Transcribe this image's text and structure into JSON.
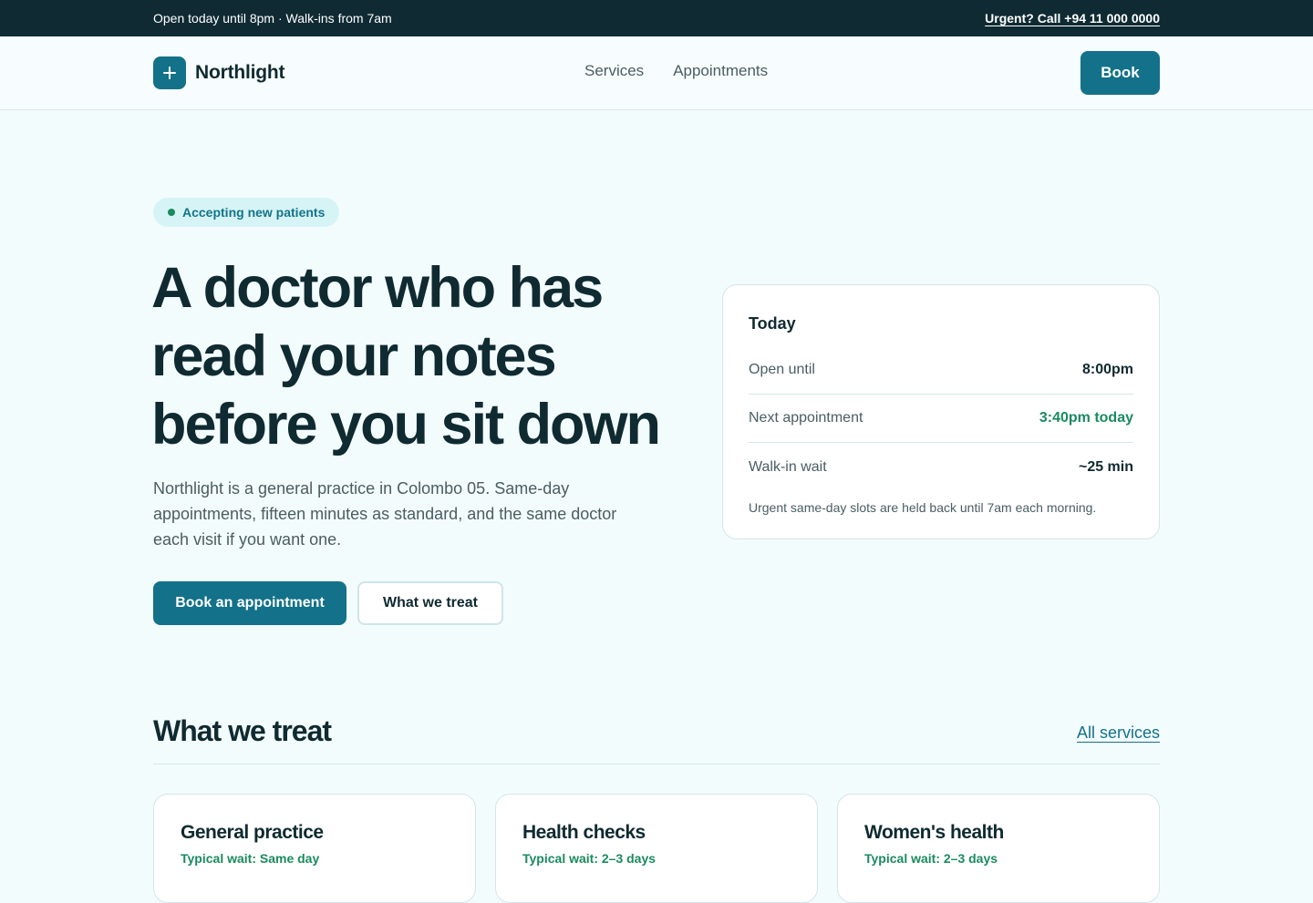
{
  "topbar": {
    "hours": "Open today until 8pm · Walk-ins from 7am",
    "urgent": "Urgent? Call +94 11 000 0000"
  },
  "nav": {
    "brand": "Northlight",
    "links": [
      "Services",
      "Appointments"
    ],
    "book_label": "Book"
  },
  "hero": {
    "badge": "Accepting new patients",
    "headline_lines": [
      "A doctor who has",
      "read your notes",
      "before you sit down"
    ],
    "lede": "Northlight is a general practice in Colombo 05. Same-day appointments, fifteen minutes as standard, and the same doctor each visit if you want one.",
    "cta_primary": "Book an appointment",
    "cta_secondary": "What we treat"
  },
  "today": {
    "title": "Today",
    "rows": [
      {
        "label": "Open until",
        "value": "8:00pm"
      },
      {
        "label": "Next appointment",
        "value": "3:40pm today"
      },
      {
        "label": "Walk-in wait",
        "value": "~25 min"
      }
    ],
    "note": "Urgent same-day slots are held back until 7am each morning."
  },
  "treat": {
    "title": "What we treat",
    "all_link": "All services",
    "cards": [
      {
        "title": "General practice",
        "wait": "Typical wait: Same day"
      },
      {
        "title": "Health checks",
        "wait": "Typical wait: 2–3 days"
      },
      {
        "title": "Women's health",
        "wait": "Typical wait: 2–3 days"
      }
    ]
  },
  "colors": {
    "accent": "#137189",
    "success": "#1a8a60",
    "dark": "#0f2a33"
  }
}
